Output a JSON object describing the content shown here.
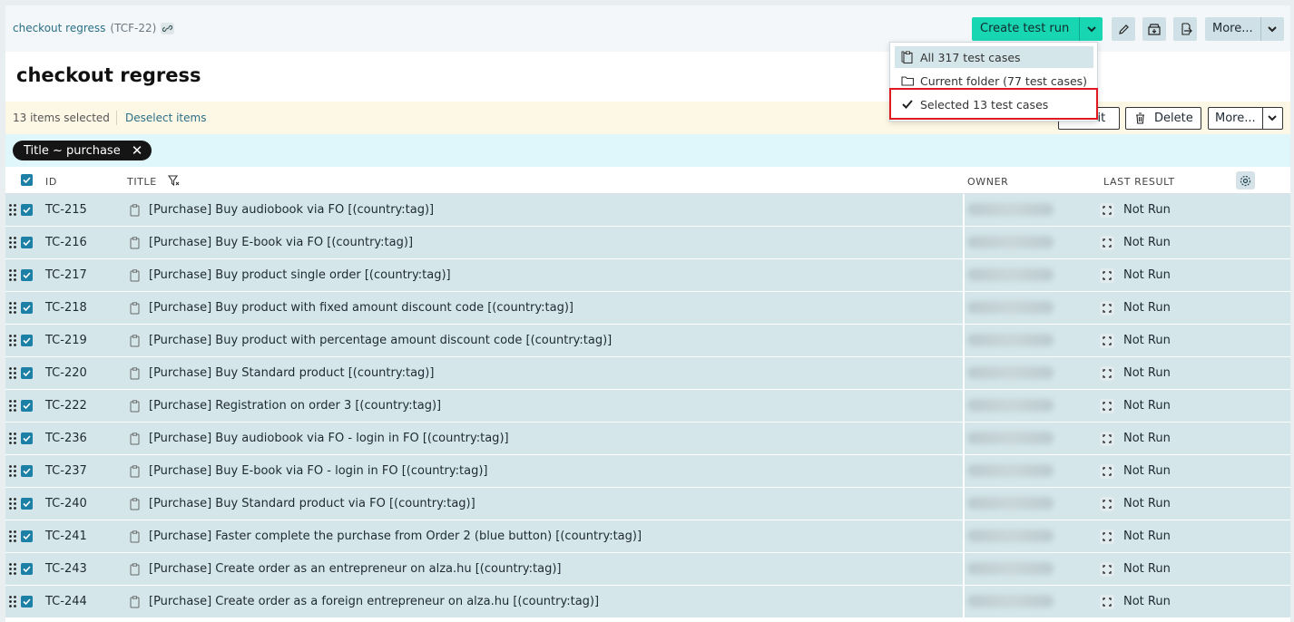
{
  "header": {
    "breadcrumb_name": "checkout regress",
    "breadcrumb_key": "(TCF-22)",
    "create_run_label": "Create test run",
    "more_label": "More...",
    "page_title": "checkout regress"
  },
  "selection": {
    "count_label": "13 items selected",
    "deselect_label": "Deselect items",
    "edit_label": "Edit",
    "delete_label": "Delete",
    "more_label": "More..."
  },
  "filter": {
    "chip_label": "Title ~ purchase"
  },
  "table": {
    "columns": {
      "id": "ID",
      "title": "TITLE",
      "owner": "OWNER",
      "last_result": "LAST RESULT"
    },
    "rows": [
      {
        "id": "TC-215",
        "title": "[Purchase] Buy audiobook via FO [(country:tag)]",
        "result": "Not Run"
      },
      {
        "id": "TC-216",
        "title": "[Purchase] Buy E-book via FO [(country:tag)]",
        "result": "Not Run"
      },
      {
        "id": "TC-217",
        "title": "[Purchase] Buy product single order [(country:tag)]",
        "result": "Not Run"
      },
      {
        "id": "TC-218",
        "title": "[Purchase] Buy product with fixed amount discount code [(country:tag)]",
        "result": "Not Run"
      },
      {
        "id": "TC-219",
        "title": "[Purchase] Buy product with percentage amount discount code [(country:tag)]",
        "result": "Not Run"
      },
      {
        "id": "TC-220",
        "title": "[Purchase] Buy Standard product [(country:tag)]",
        "result": "Not Run"
      },
      {
        "id": "TC-222",
        "title": "[Purchase] Registration on order 3 [(country:tag)]",
        "result": "Not Run"
      },
      {
        "id": "TC-236",
        "title": "[Purchase] Buy audiobook via FO - login in FO [(country:tag)]",
        "result": "Not Run"
      },
      {
        "id": "TC-237",
        "title": "[Purchase] Buy E-book via FO - login in FO [(country:tag)]",
        "result": "Not Run"
      },
      {
        "id": "TC-240",
        "title": "[Purchase] Buy Standard product via FO [(country:tag)]",
        "result": "Not Run"
      },
      {
        "id": "TC-241",
        "title": "[Purchase] Faster complete the purchase from Order 2 (blue button) [(country:tag)]",
        "result": "Not Run"
      },
      {
        "id": "TC-243",
        "title": "[Purchase] Create order as an entrepreneur on alza.hu [(country:tag)]",
        "result": "Not Run"
      },
      {
        "id": "TC-244",
        "title": "[Purchase] Create order as a foreign entrepreneur on alza.hu [(country:tag)]",
        "result": "Not Run"
      }
    ]
  },
  "dropdown": {
    "items": [
      {
        "label": "All 317 test cases",
        "icon": "clipboard-stack-icon"
      },
      {
        "label": "Current folder (77 test cases)",
        "icon": "folder-icon"
      },
      {
        "label": "Selected 13 test cases",
        "icon": "check-icon"
      }
    ]
  },
  "colors": {
    "accent": "#19d6b3",
    "row_selected": "#d4e6ea",
    "checkbox": "#1b7fa6",
    "highlight_border": "#e0181f"
  }
}
